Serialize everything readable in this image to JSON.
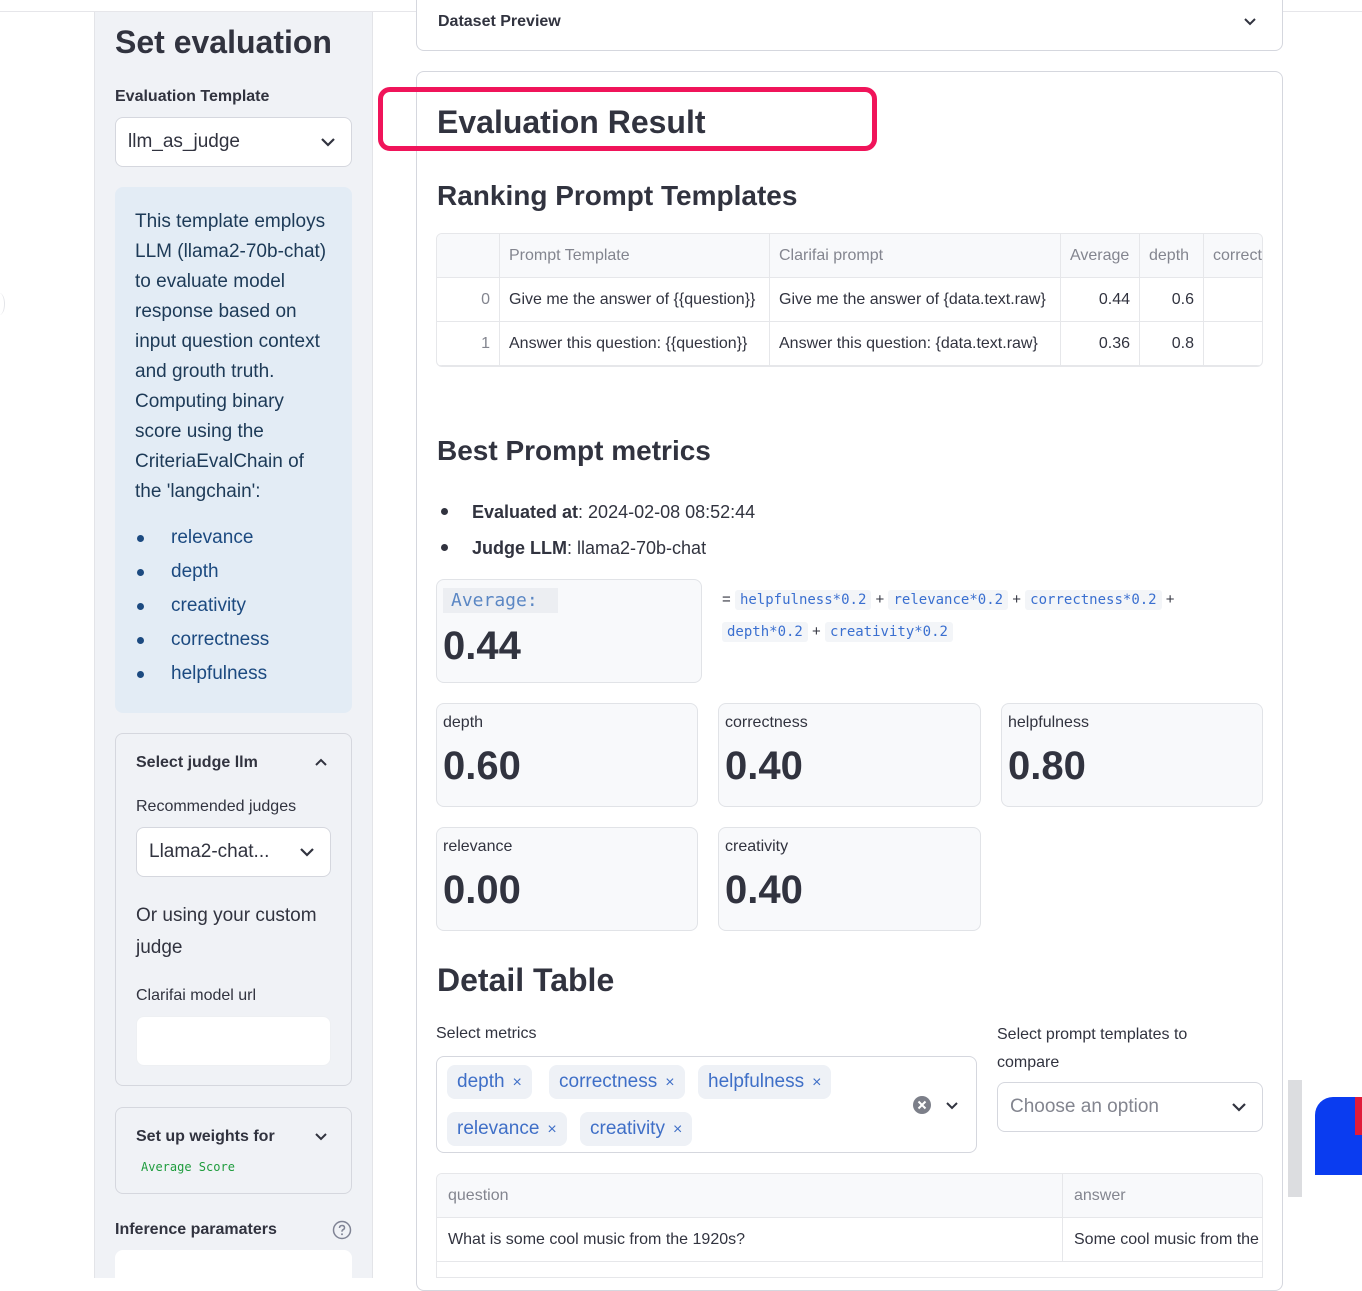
{
  "sidebar": {
    "title": "Set evaluation",
    "template_label": "Evaluation Template",
    "template_value": "llm_as_judge",
    "info_text": "This template employs LLM (llama2-70b-chat) to evaluate model response based on input question context and grouth truth. Computing binary score using the CriteriaEvalChain of the 'langchain':",
    "criteria": [
      "relevance",
      "depth",
      "creativity",
      "correctness",
      "helpfulness"
    ],
    "judge_panel": {
      "title": "Select judge llm",
      "recommended_label": "Recommended judges",
      "recommended_value": "Llama2-chat...",
      "custom_text": "Or using your custom judge",
      "url_label": "Clarifai model url",
      "url_value": ""
    },
    "weights_panel": {
      "title": "Set up weights for",
      "code": "Average Score"
    },
    "inference_label": "Inference paramaters"
  },
  "main": {
    "dataset_preview": "Dataset Preview",
    "eval_title": "Evaluation Result",
    "ranking_title": "Ranking Prompt Templates",
    "ranking_table": {
      "headers": [
        "",
        "Prompt Template",
        "Clarifai prompt",
        "Average",
        "depth",
        "correct"
      ],
      "rows": [
        [
          "0",
          "Give me the answer of {{question}}",
          "Give me the answer of {data.text.raw}",
          "0.44",
          "0.6",
          ""
        ],
        [
          "1",
          "Answer this question: {{question}}",
          "Answer this question: {data.text.raw}",
          "0.36",
          "0.8",
          ""
        ]
      ]
    },
    "best_title": "Best Prompt metrics",
    "evaluated_at_label": "Evaluated at",
    "evaluated_at_value": ": 2024-02-08 08:52:44",
    "judge_llm_label": "Judge LLM",
    "judge_llm_value": ": llama2-70b-chat",
    "average_label": "Average:",
    "average_value": "0.44",
    "formula": {
      "eq": "=",
      "plus": "+",
      "terms": [
        "helpfulness*0.2",
        "relevance*0.2",
        "correctness*0.2",
        "depth*0.2",
        "creativity*0.2"
      ]
    },
    "metrics": [
      {
        "label": "depth",
        "value": "0.60"
      },
      {
        "label": "correctness",
        "value": "0.40"
      },
      {
        "label": "helpfulness",
        "value": "0.80"
      },
      {
        "label": "relevance",
        "value": "0.00"
      },
      {
        "label": "creativity",
        "value": "0.40"
      }
    ],
    "detail_title": "Detail Table",
    "select_metrics_label": "Select metrics",
    "selected_metrics": [
      "depth",
      "correctness",
      "helpfulness",
      "relevance",
      "creativity"
    ],
    "remove_glyph": "×",
    "compare_label": "Select prompt templates to compare",
    "compare_placeholder": "Choose an option",
    "detail_table": {
      "headers": [
        "question",
        "answer"
      ],
      "rows": [
        [
          "What is some cool music from the 1920s?",
          "Some cool music from the"
        ]
      ]
    }
  }
}
